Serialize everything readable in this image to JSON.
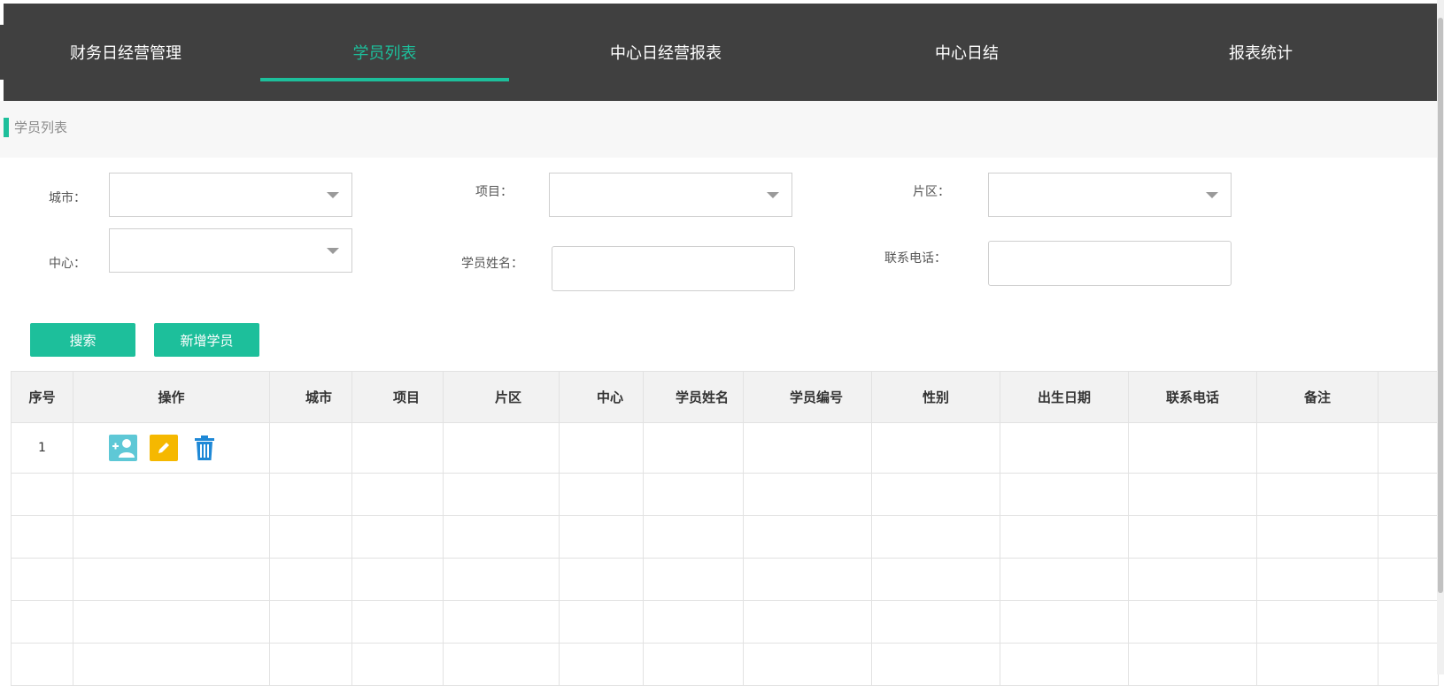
{
  "nav": {
    "tabs": [
      {
        "label": "财务日经营管理"
      },
      {
        "label": "学员列表"
      },
      {
        "label": "中心日经营报表"
      },
      {
        "label": "中心日结"
      },
      {
        "label": "报表统计"
      }
    ],
    "active_tab": "学员列表"
  },
  "breadcrumb": {
    "title": "学员列表"
  },
  "filters": {
    "city_label": "城市：",
    "project_label": "项目：",
    "district_label": "片区：",
    "center_label": "中心：",
    "student_name_label": "学员姓名：",
    "phone_label": "联系电话：",
    "city_value": "",
    "project_value": "",
    "district_value": "",
    "center_value": "",
    "student_name_value": "",
    "phone_value": ""
  },
  "actions": {
    "search_label": "搜索",
    "add_student_label": "新增学员"
  },
  "table": {
    "columns": [
      "序号",
      "操作",
      "城市",
      "项目",
      "片区",
      "中心",
      "学员姓名",
      "学员编号",
      "性别",
      "出生日期",
      "联系电话",
      "备注",
      ""
    ],
    "rows": [
      {
        "index": "1",
        "city": "",
        "project": "",
        "district": "",
        "center": "",
        "name": "",
        "code": "",
        "gender": "",
        "birth": "",
        "phone": "",
        "note": ""
      }
    ]
  },
  "colors": {
    "accent": "#1dbf9b",
    "topbar": "#404040",
    "icon_user": "#5ec8d6",
    "icon_edit": "#f5b800",
    "icon_delete": "#1e88d6"
  }
}
